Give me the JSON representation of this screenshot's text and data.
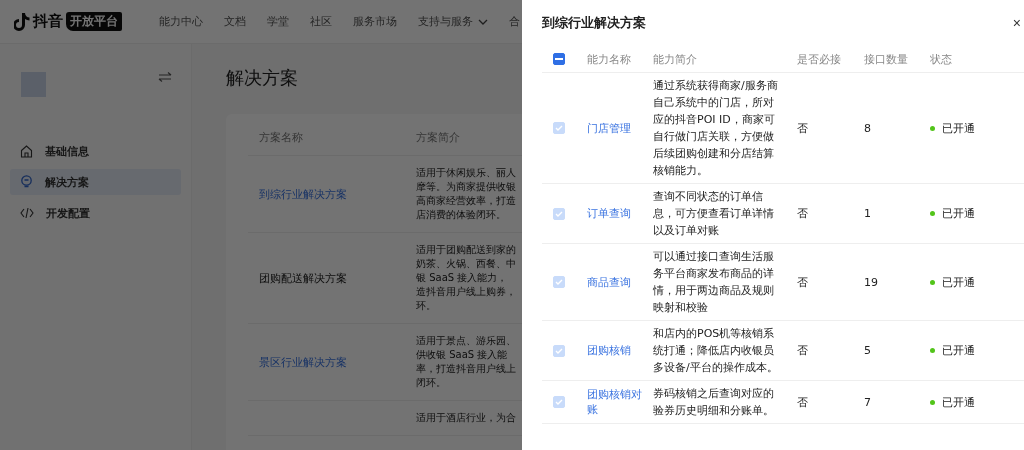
{
  "header": {
    "logo_text": "抖音",
    "logo_badge": "开放平台",
    "nav": [
      {
        "label": "能力中心",
        "dropdown": false
      },
      {
        "label": "文档",
        "dropdown": false
      },
      {
        "label": "学堂",
        "dropdown": false
      },
      {
        "label": "社区",
        "dropdown": false
      },
      {
        "label": "服务市场",
        "dropdown": false
      },
      {
        "label": "支持与服务",
        "dropdown": true
      },
      {
        "label": "合",
        "dropdown": false
      }
    ]
  },
  "sidebar": {
    "items": [
      {
        "label": "基础信息",
        "selected": false
      },
      {
        "label": "解决方案",
        "selected": true
      },
      {
        "label": "开发配置",
        "selected": false
      }
    ]
  },
  "page": {
    "title": "解决方案",
    "table": {
      "columns": [
        "方案名称",
        "方案简介"
      ],
      "rows": [
        {
          "name": "到综行业解决方案",
          "link": true,
          "intro": [
            "适用于休闲娱乐、丽人",
            "摩等。为商家提供收银",
            "高商家经营效率，打造",
            "店消费的体验闭环。"
          ]
        },
        {
          "name": "团购配送解决方案",
          "link": false,
          "intro": [
            "适用于团购配送到家的",
            "奶茶、火锅、西餐、中",
            "银 SaaS 接入能力，",
            "造抖音用户线上购券，",
            "环。"
          ]
        },
        {
          "name": "景区行业解决方案",
          "link": true,
          "intro": [
            "适用于景点、游乐园、",
            "供收银 SaaS 接入能",
            "率，打造抖音用户线上",
            "闭环。"
          ]
        },
        {
          "intro": [
            "适用于酒店行业，为合"
          ]
        }
      ]
    }
  },
  "drawer": {
    "title": "到综行业解决方案",
    "close": "×",
    "select_all": {
      "checked": true,
      "indeterminate": true
    },
    "columns": [
      "能力名称",
      "能力简介",
      "是否必接",
      "接口数量",
      "状态"
    ],
    "rows": [
      {
        "checked": true,
        "disabled": true,
        "name": "门店管理",
        "intro": "通过系统获得商家/服务商自己系统中的门店，所对应的抖音POI ID，商家可自行做门店关联，方便做后续团购创建和分店结算核销能力。",
        "required": "否",
        "count": "8",
        "status": "已开通",
        "color": "#52c41a"
      },
      {
        "checked": true,
        "disabled": true,
        "name": "订单查询",
        "intro": "查询不同状态的订单信息，可方便查看订单详情以及订单对账",
        "required": "否",
        "count": "1",
        "status": "已开通",
        "color": "#52c41a"
      },
      {
        "checked": true,
        "disabled": true,
        "name": "商品查询",
        "intro": "可以通过接口查询生活服务平台商家发布商品的详情，用于两边商品及规则映射和校验",
        "required": "否",
        "count": "19",
        "status": "已开通",
        "color": "#52c41a"
      },
      {
        "checked": true,
        "disabled": true,
        "name": "团购核销",
        "intro": "和店内的POS机等核销系统打通；降低店内收银员多设备/平台的操作成本。",
        "required": "否",
        "count": "5",
        "status": "已开通",
        "color": "#52c41a"
      },
      {
        "checked": true,
        "disabled": true,
        "name": "团购核销对账",
        "intro": "券码核销之后查询对应的验券历史明细和分账单。",
        "required": "否",
        "count": "7",
        "status": "已开通",
        "color": "#52c41a"
      }
    ]
  }
}
